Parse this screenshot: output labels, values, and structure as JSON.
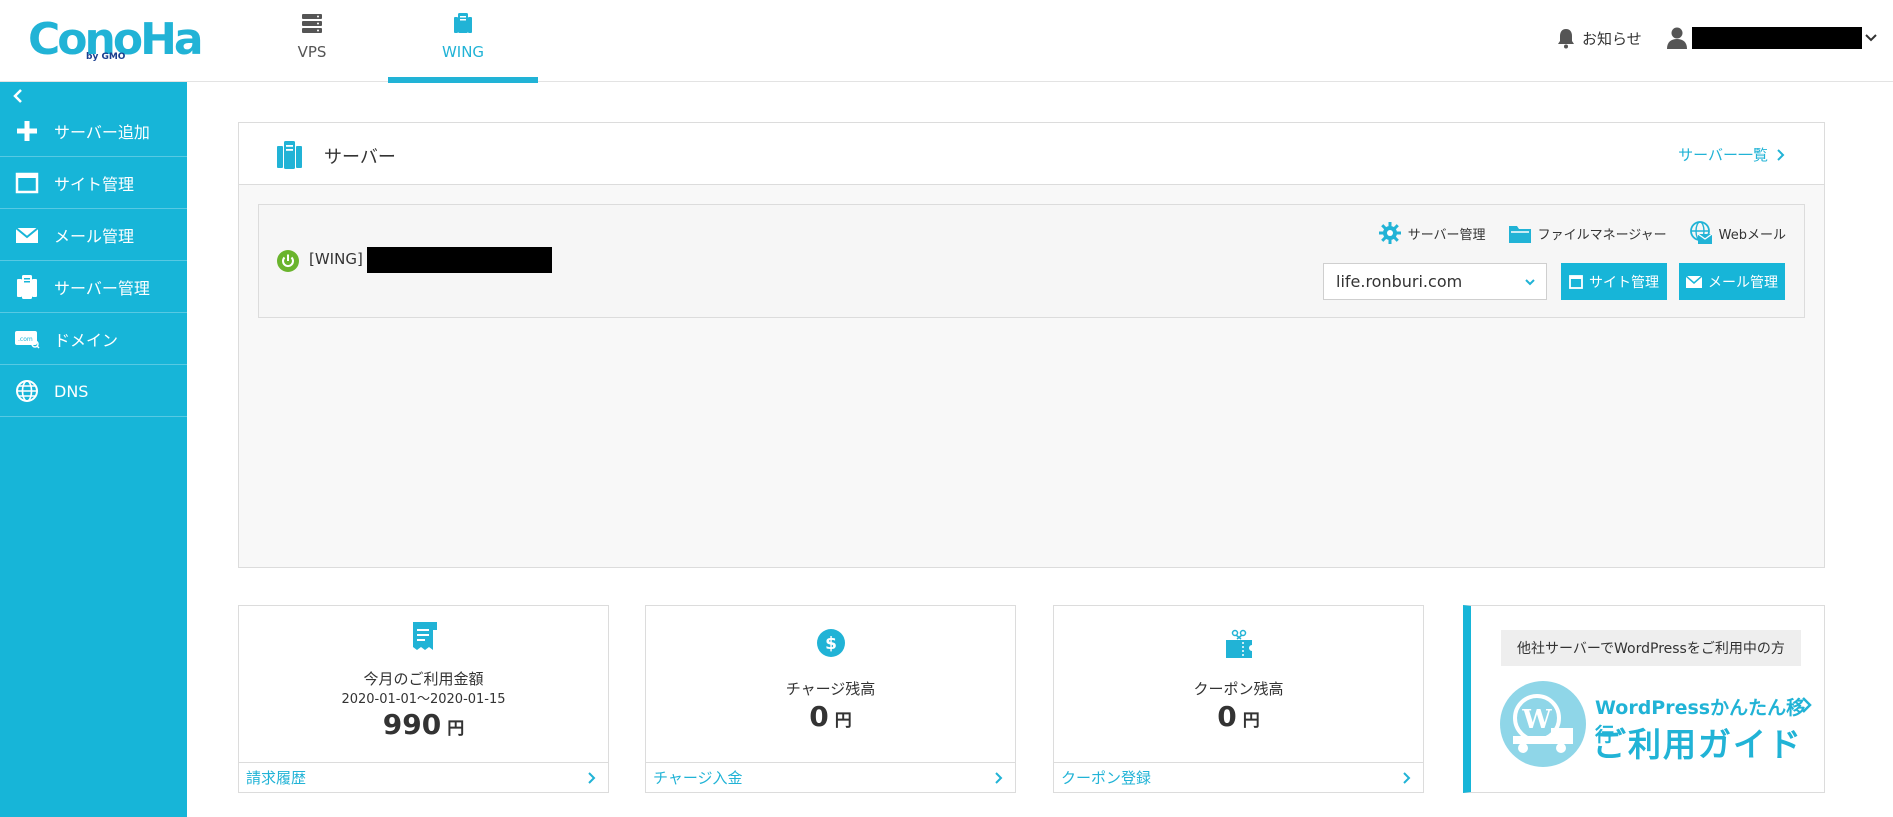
{
  "brand": {
    "name": "ConoHa",
    "sub": "by GMO",
    "color": "#21b3d6"
  },
  "header": {
    "tabs": [
      {
        "label": "VPS",
        "icon": "server-stack-icon",
        "active": false
      },
      {
        "label": "WING",
        "icon": "wing-server-icon",
        "active": true
      }
    ],
    "notify_label": "お知らせ",
    "user_icon": "user-icon"
  },
  "sidebar": {
    "collapse_icon": "chevron-left-icon",
    "items": [
      {
        "label": "サーバー追加",
        "icon": "plus-icon"
      },
      {
        "label": "サイト管理",
        "icon": "window-icon"
      },
      {
        "label": "メール管理",
        "icon": "mail-icon"
      },
      {
        "label": "サーバー管理",
        "icon": "server-icon"
      },
      {
        "label": "ドメイン",
        "icon": "domain-icon"
      },
      {
        "label": "DNS",
        "icon": "globe-icon"
      }
    ]
  },
  "server_panel": {
    "title": "サーバー",
    "list_link": "サーバー一覧",
    "server": {
      "name": "[WING]",
      "status": "running",
      "tools": [
        {
          "label": "サーバー管理",
          "icon": "gear-icon"
        },
        {
          "label": "ファイルマネージャー",
          "icon": "folder-icon"
        },
        {
          "label": "Webメール",
          "icon": "webmail-icon"
        }
      ],
      "selected_domain": "life.ronburi.com",
      "site_button": "サイト管理",
      "mail_button": "メール管理"
    }
  },
  "cards": {
    "usage": {
      "title": "今月のご利用金額",
      "period": "2020-01-01～2020-01-15",
      "amount": "990",
      "unit": "円",
      "link": "請求履歴"
    },
    "charge": {
      "title": "チャージ残高",
      "amount": "0",
      "unit": "円",
      "link": "チャージ入金"
    },
    "coupon": {
      "title": "クーポン残高",
      "amount": "0",
      "unit": "円",
      "link": "クーポン登録"
    }
  },
  "guide": {
    "tag": "他社サーバーでWordPressをご利用中の方",
    "line1": "WordPressかんたん移行",
    "line2": "ご利用ガイド"
  }
}
